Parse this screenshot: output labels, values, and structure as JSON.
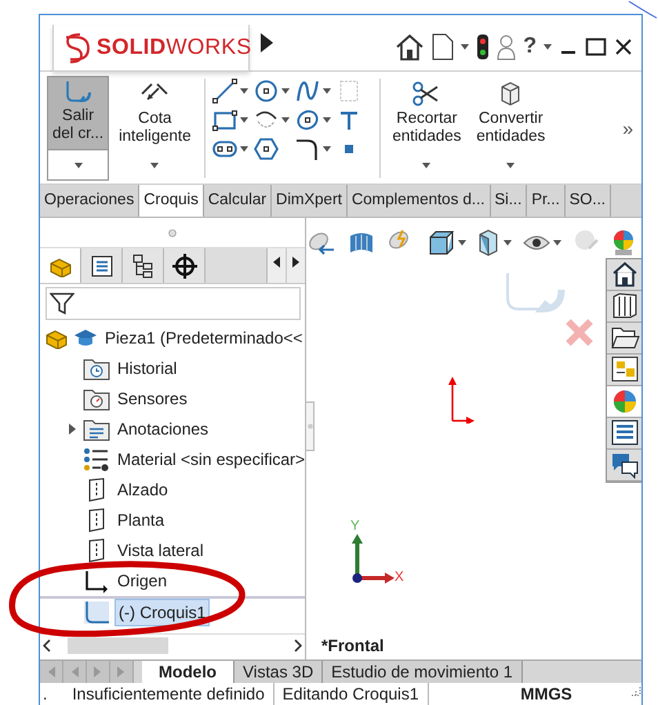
{
  "title_bar": {
    "logo": "**SOLID**WORKS",
    "help": "?"
  },
  "ribbon": {
    "commands": [
      {
        "kind": "exit_sketch",
        "label": "Salir\ndel cr...",
        "selected": true,
        "dropdown": true
      },
      {
        "kind": "smart_dimension",
        "label": "Cota\ninteligente",
        "selected": false,
        "dropdown": true
      },
      {
        "kind": "tools"
      },
      {
        "kind": "trim",
        "label": "Recortar\nentidades",
        "selected": false,
        "dropdown": true
      },
      {
        "kind": "convert",
        "label": "Convertir\nentidades",
        "selected": false,
        "dropdown": true
      }
    ],
    "overflow": "»"
  },
  "tabs": [
    {
      "label": "Operaciones",
      "selected": false
    },
    {
      "label": "Croquis",
      "selected": true
    },
    {
      "label": "Calcular",
      "selected": false
    },
    {
      "label": "DimXpert",
      "selected": false
    },
    {
      "label": "Complementos d...",
      "selected": false
    },
    {
      "label": "Si...",
      "selected": false
    },
    {
      "label": "Pr...",
      "selected": false
    },
    {
      "label": "SO...",
      "selected": false
    }
  ],
  "feature_manager": {
    "tabs": [
      {
        "kind": "part",
        "selected": true
      },
      {
        "kind": "properties",
        "selected": false
      },
      {
        "kind": "config",
        "selected": false
      },
      {
        "kind": "target",
        "selected": false
      }
    ],
    "tree": {
      "label": "Pieza1  (Predeterminado<<",
      "kind": "part",
      "selected": false,
      "children": [
        {
          "label": "Historial",
          "kind": "history",
          "collapsed": false,
          "selected": false
        },
        {
          "label": "Sensores",
          "kind": "sensor",
          "collapsed": false,
          "selected": false
        },
        {
          "label": "Anotaciones",
          "kind": "annotation",
          "collapsed": true,
          "selected": false
        },
        {
          "label": "Material <sin especificar>",
          "kind": "material",
          "collapsed": false,
          "selected": false
        },
        {
          "label": "Alzado",
          "kind": "plane",
          "collapsed": false,
          "selected": false
        },
        {
          "label": "Planta",
          "kind": "plane",
          "collapsed": false,
          "selected": false
        },
        {
          "label": "Vista lateral",
          "kind": "plane",
          "collapsed": false,
          "selected": false
        },
        {
          "label": "Origen",
          "kind": "origin",
          "collapsed": false,
          "selected": false
        },
        {
          "label": "(-) Croquis1",
          "kind": "sketch",
          "collapsed": false,
          "selected": true
        }
      ]
    }
  },
  "graphics": {
    "view_name": "*Frontal",
    "triad": {
      "x": "X",
      "y": "Y"
    },
    "task_pane": [
      {
        "kind": "home",
        "selected": false
      },
      {
        "kind": "library",
        "selected": false
      },
      {
        "kind": "folder",
        "selected": false
      },
      {
        "kind": "palette",
        "selected": false
      },
      {
        "kind": "appearance",
        "selected": true
      },
      {
        "kind": "properties",
        "selected": false
      },
      {
        "kind": "forum",
        "selected": false
      }
    ]
  },
  "bottom_tabs": [
    {
      "label": "Modelo",
      "selected": true
    },
    {
      "label": "Vistas 3D",
      "selected": false
    },
    {
      "label": "Estudio de movimiento 1",
      "selected": false
    }
  ],
  "status_bar": [
    ".",
    "Insuficientemente definido",
    "Editando Croquis1",
    "MMGS"
  ]
}
